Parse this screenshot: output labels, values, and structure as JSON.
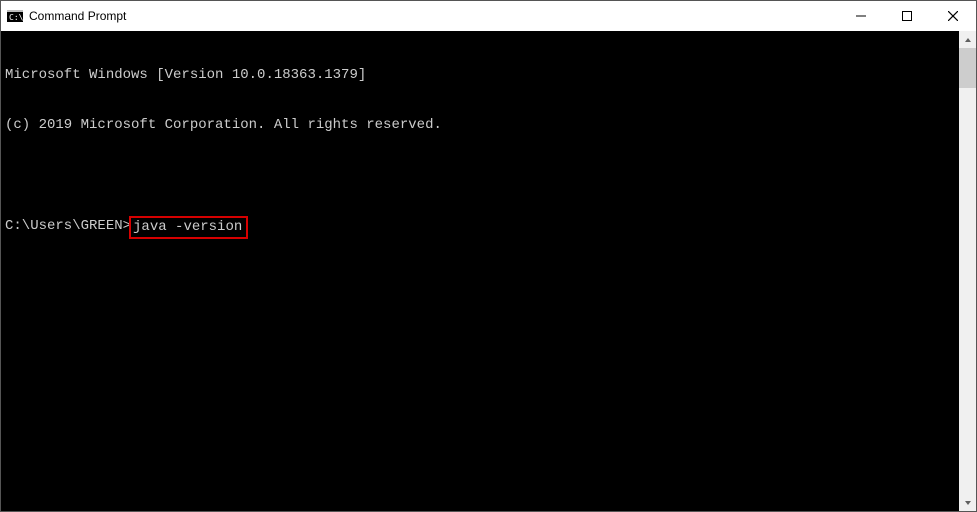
{
  "titlebar": {
    "title": "Command Prompt"
  },
  "terminal": {
    "line1": "Microsoft Windows [Version 10.0.18363.1379]",
    "line2": "(c) 2019 Microsoft Corporation. All rights reserved.",
    "blank": " ",
    "prompt": "C:\\Users\\GREEN>",
    "command": "java -version"
  }
}
